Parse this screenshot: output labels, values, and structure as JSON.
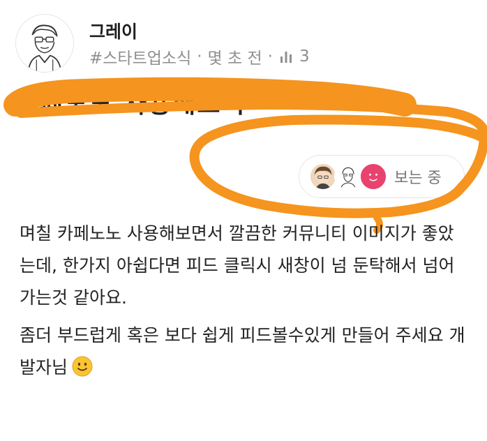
{
  "author": {
    "name": "그레이",
    "avatar_icon": "sketch-person-avatar-icon"
  },
  "meta": {
    "topic": "#스타트업소식",
    "separator": "·",
    "time": "몇 초 전",
    "views_icon": "bar-chart-icon",
    "views": "3"
  },
  "post": {
    "title": "카페노노 사용해보니",
    "viewing": {
      "label": "보는 중",
      "viewer_icons": [
        "viewer-avatar-icon",
        "viewer-avatar-icon",
        "viewer-avatar-icon"
      ]
    },
    "paragraphs": [
      "며칠 카페노노 사용해보면서 깔끔한 커뮤니티 이미지가 좋았는데, 한가지 아쉽다면 피드 클릭시 새창이 넘 둔탁해서 넘어가는것 같아요.",
      "좀더 부드럽게 혹은 보다 쉽게 피드볼수있게 만들어 주세요 개발자님"
    ],
    "emoji": "smile-emoji-icon"
  },
  "colors": {
    "redaction": "#f5941e",
    "meta_text": "#8f8f8f",
    "viewer_pink": "#e8436f"
  }
}
